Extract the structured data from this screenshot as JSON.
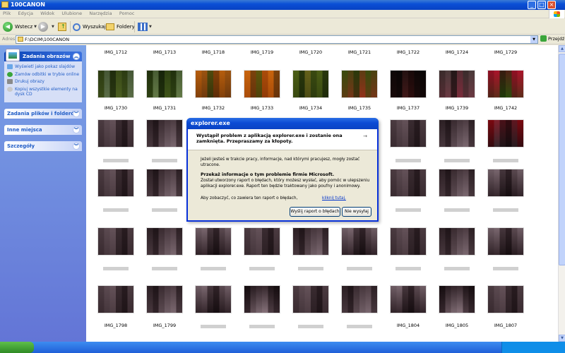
{
  "window": {
    "title": "100CANON"
  },
  "menu": [
    "Plik",
    "Edycja",
    "Widok",
    "Ulubione",
    "Narzędzia",
    "Pomoc"
  ],
  "toolbar": {
    "back_label": "Wstecz",
    "search_label": "Wyszukaj",
    "folders_label": "Foldery"
  },
  "address": {
    "label": "Adres",
    "path": "F:\\DCIM\\100CANON",
    "go_label": "Przejdź"
  },
  "sidebar": {
    "picture_tasks": {
      "title": "Zadania obrazów",
      "items": [
        "Wyświetl jako pokaz slajdów",
        "Zamów odbitki w trybie online",
        "Drukuj obrazy",
        "Kopiuj wszystkie elementy na dysk CD"
      ]
    },
    "file_tasks": {
      "title": "Zadania plików i folderów"
    },
    "other_places": {
      "title": "Inne miejsca"
    },
    "details": {
      "title": "Szczegóły"
    }
  },
  "files": {
    "top_labels": [
      "IMG_1712",
      "IMG_1713",
      "IMG_1718",
      "IMG_1719",
      "IMG_1720",
      "IMG_1721",
      "IMG_1722",
      "IMG_1724",
      "IMG_1729"
    ],
    "row1_labels": [
      "IMG_1730",
      "IMG_1731",
      "IMG_1732",
      "IMG_1733",
      "IMG_1734",
      "IMG_1735",
      "IMG_1737",
      "IMG_1739",
      "IMG_1742"
    ],
    "bottom_labels": [
      "IMG_1798",
      "IMG_1799",
      "",
      "",
      "",
      "",
      "IMG_1804",
      "IMG_1805",
      "IMG_1807"
    ]
  },
  "dialog": {
    "title": "explorer.exe",
    "headline": "Wystąpił problem z aplikacją explorer.exe i zostanie ona zamknięta. Przepraszamy za kłopoty.",
    "info": "Jeżeli jesteś w trakcie pracy, informacje, nad którymi pracujesz, mogły zostać utracone.",
    "report_title": "Przekaż informacje o tym problemie firmie Microsoft.",
    "report_body": "Został utworzony raport o błędach, który możesz wysłać, aby pomóc w ulepszeniu aplikacji explorer.exe. Raport ten będzie traktowany jako poufny i anonimowy.",
    "see_text": "Aby zobaczyć, co zawiera ten raport o błędach,",
    "see_link": "kliknij tutaj.",
    "send_label": "Wyślij raport o błędach",
    "dont_send_label": "Nie wysyłaj"
  }
}
